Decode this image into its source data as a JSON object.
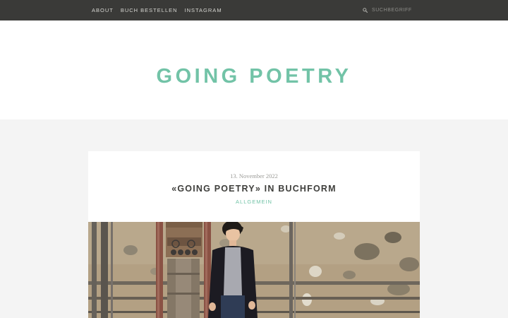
{
  "nav": {
    "items": [
      {
        "label": "ABOUT"
      },
      {
        "label": "BUCH BESTELLEN"
      },
      {
        "label": "INSTAGRAM"
      }
    ]
  },
  "search": {
    "placeholder": "SUCHBEGRIFF",
    "icon": "search-icon"
  },
  "site": {
    "title": "GOING POETRY"
  },
  "post": {
    "date": "13. November 2022",
    "title": "«GOING POETRY» IN BUCHFORM",
    "category": "ALLGEMEIN"
  },
  "colors": {
    "accent": "#72c3a7",
    "topbar": "#3a3a38",
    "page_background": "#f4f4f4"
  }
}
